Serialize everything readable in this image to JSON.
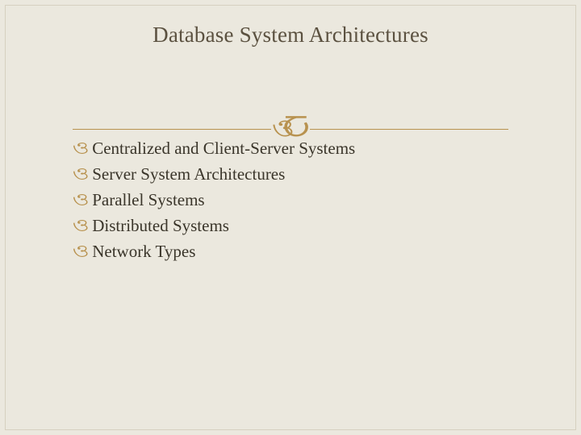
{
  "title": "Database System Architectures",
  "colors": {
    "background": "#ebe8de",
    "accent": "#b8924f",
    "text_title": "#5b5140",
    "text_body": "#3a352a"
  },
  "bullets": [
    {
      "text": "Centralized and Client-Server Systems"
    },
    {
      "text": "Server System Architectures"
    },
    {
      "text": "Parallel Systems"
    },
    {
      "text": "Distributed Systems"
    },
    {
      "text": "Network Types"
    }
  ]
}
